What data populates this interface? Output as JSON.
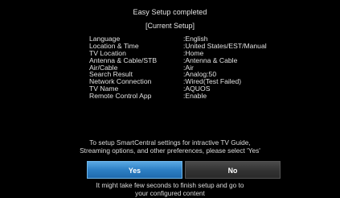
{
  "title": "Easy Setup completed",
  "subtitle": "[Current Setup]",
  "settings": [
    {
      "label": "Language",
      "value": ":English"
    },
    {
      "label": "Location & Time",
      "value": ":United States/EST/Manual"
    },
    {
      "label": "TV Location",
      "value": ":Home"
    },
    {
      "label": "Antenna & Cable/STB",
      "value": ":Antenna & Cable"
    },
    {
      "label": "Air/Cable",
      "value": ":Air"
    },
    {
      "label": "Search Result",
      "value": ":Analog:50"
    },
    {
      "label": "Network Connection",
      "value": ":Wired(Test Failed)"
    },
    {
      "label": "TV Name",
      "value": ":AQUOS"
    },
    {
      "label": "Remote Control App",
      "value": ":Enable"
    }
  ],
  "info": {
    "line1": "To setup SmartCentral settings for intractive TV Guide,",
    "line2": "Streaming options, and other preferences, please select 'Yes'"
  },
  "buttons": {
    "yes_label": "Yes",
    "no_label": "No"
  },
  "footer": {
    "line1": "It might take few seconds to finish setup and go to",
    "line2": "your configured content"
  },
  "colors": {
    "background": "#000000",
    "yes_button": "#2d7fc4",
    "no_button": "#333333"
  }
}
